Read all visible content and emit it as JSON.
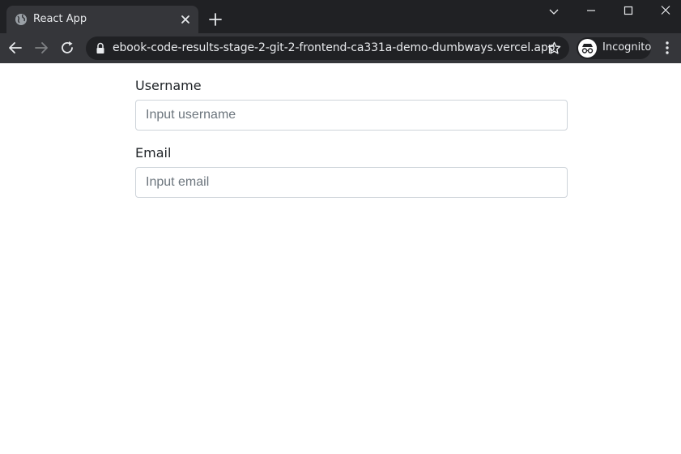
{
  "browser": {
    "tab": {
      "title": "React App",
      "favicon": "globe-icon"
    },
    "address_bar": {
      "url": "ebook-code-results-stage-2-git-2-frontend-ca331a-demo-dumbways.vercel.app",
      "secure_icon": "lock-icon"
    },
    "profile": {
      "label": "Incognito",
      "icon": "incognito-icon"
    },
    "colors": {
      "tabstrip": "#202124",
      "toolbar": "#35363a",
      "text": "#e8eaed"
    }
  },
  "form": {
    "username": {
      "label": "Username",
      "placeholder": "Input username",
      "value": ""
    },
    "email": {
      "label": "Email",
      "placeholder": "Input email",
      "value": ""
    }
  }
}
